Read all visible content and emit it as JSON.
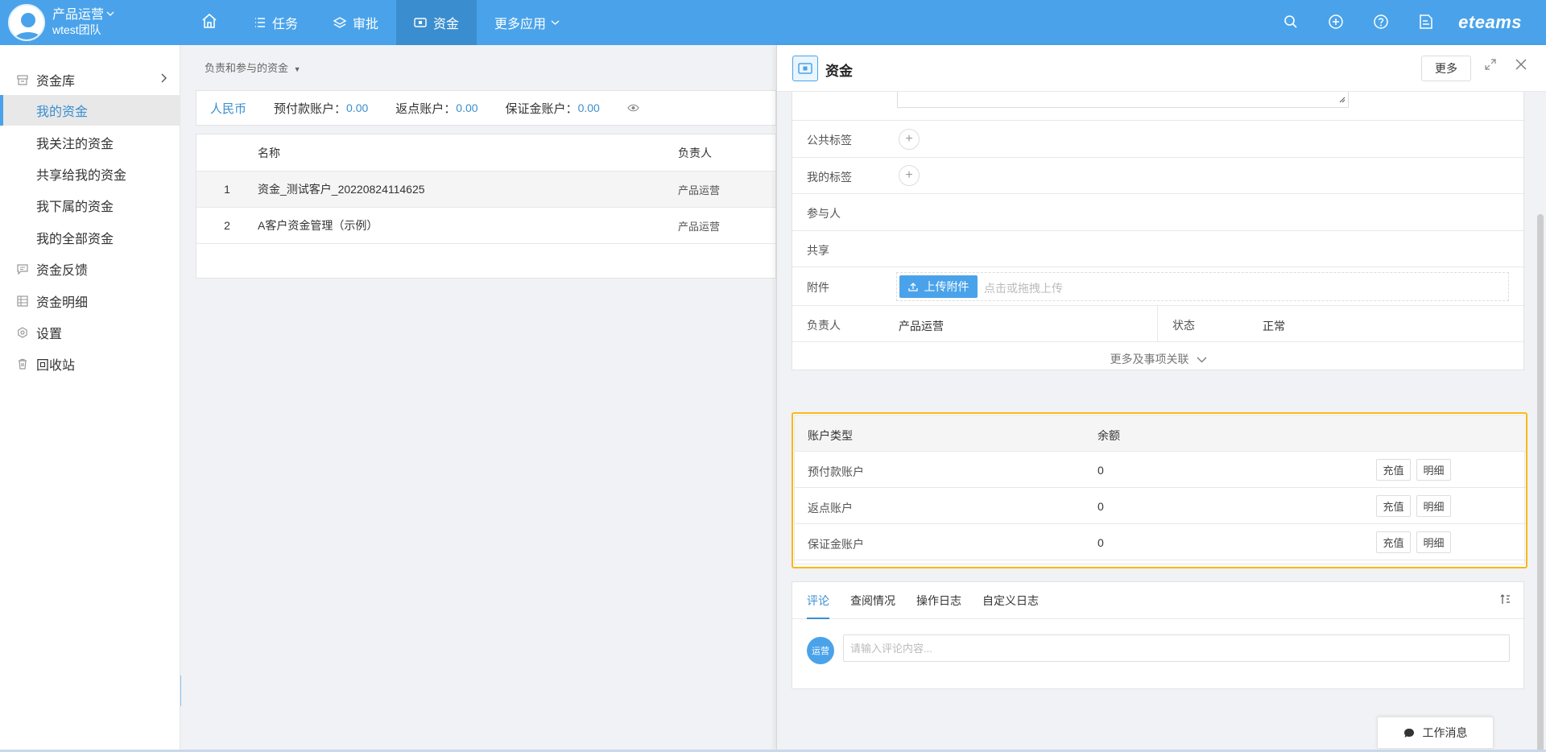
{
  "topbar": {
    "user_name": "产品运营",
    "user_team": "wtest团队",
    "nav": [
      {
        "label": "任务",
        "icon": "list-icon"
      },
      {
        "label": "审批",
        "icon": "layers-icon"
      },
      {
        "label": "资金",
        "icon": "wallet-icon"
      },
      {
        "label": "更多应用",
        "icon": "chevron-down-icon"
      }
    ],
    "logo": "eteams",
    "accent": "#4aa3ea",
    "active_nav": "#3a8ecf"
  },
  "sidebar": {
    "group_label": "资金库",
    "sub_items": [
      "我的资金",
      "我关注的资金",
      "共享给我的资金",
      "我下属的资金",
      "我的全部资金"
    ],
    "items": [
      {
        "label": "资金反馈",
        "icon": "feedback-icon"
      },
      {
        "label": "资金明细",
        "icon": "table-icon"
      },
      {
        "label": "设置",
        "icon": "gear-icon"
      },
      {
        "label": "回收站",
        "icon": "trash-icon"
      }
    ]
  },
  "main": {
    "filter_label": "负责和参与的资金",
    "currency": "人民币",
    "balances": [
      {
        "label": "预付款账户：",
        "value": "0.00"
      },
      {
        "label": "返点账户：",
        "value": "0.00"
      },
      {
        "label": "保证金账户：",
        "value": "0.00"
      }
    ],
    "table": {
      "headers": [
        "名称",
        "负责人"
      ],
      "rows": [
        {
          "idx": "1",
          "name": "资金_测试客户_20220824114625",
          "owner": "产品运营"
        },
        {
          "idx": "2",
          "name": "A客户资金管理（示例）",
          "owner": "产品运营"
        }
      ]
    }
  },
  "panel": {
    "title": "资金",
    "more_label": "更多",
    "fields": {
      "public_tags": "公共标签",
      "my_tags": "我的标签",
      "participants": "参与人",
      "share": "共享",
      "attachment": "附件",
      "upload_label": "上传附件",
      "upload_hint": "点击或拖拽上传",
      "owner_label": "负责人",
      "owner_value": "产品运营",
      "status_label": "状态",
      "status_value": "正常",
      "more_relations": "更多及事项关联"
    },
    "accounts": {
      "header_type": "账户类型",
      "header_balance": "余额",
      "charge_label": "充值",
      "detail_label": "明细",
      "rows": [
        {
          "type": "预付款账户",
          "balance": "0"
        },
        {
          "type": "返点账户",
          "balance": "0"
        },
        {
          "type": "保证金账户",
          "balance": "0"
        }
      ],
      "highlight": "#fab814"
    },
    "comments": {
      "tabs": [
        "评论",
        "查阅情况",
        "操作日志",
        "自定义日志"
      ],
      "avatar_text": "运营",
      "placeholder": "请输入评论内容..."
    },
    "work_msg": "工作消息"
  }
}
